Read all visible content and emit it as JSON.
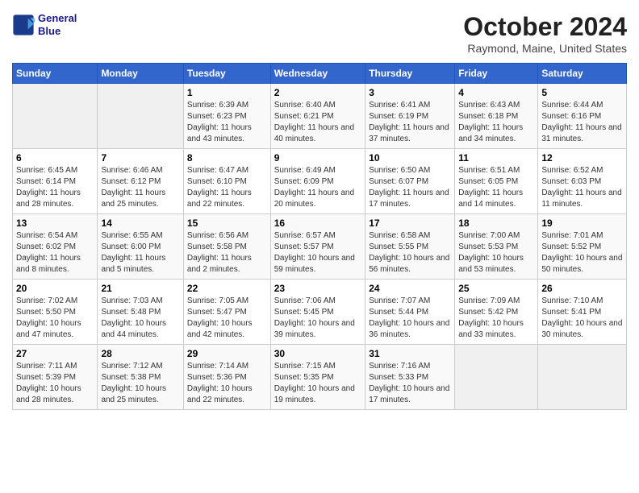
{
  "logo": {
    "line1": "General",
    "line2": "Blue"
  },
  "title": "October 2024",
  "subtitle": "Raymond, Maine, United States",
  "headers": [
    "Sunday",
    "Monday",
    "Tuesday",
    "Wednesday",
    "Thursday",
    "Friday",
    "Saturday"
  ],
  "weeks": [
    [
      {
        "day": "",
        "info": ""
      },
      {
        "day": "",
        "info": ""
      },
      {
        "day": "1",
        "info": "Sunrise: 6:39 AM\nSunset: 6:23 PM\nDaylight: 11 hours and 43 minutes."
      },
      {
        "day": "2",
        "info": "Sunrise: 6:40 AM\nSunset: 6:21 PM\nDaylight: 11 hours and 40 minutes."
      },
      {
        "day": "3",
        "info": "Sunrise: 6:41 AM\nSunset: 6:19 PM\nDaylight: 11 hours and 37 minutes."
      },
      {
        "day": "4",
        "info": "Sunrise: 6:43 AM\nSunset: 6:18 PM\nDaylight: 11 hours and 34 minutes."
      },
      {
        "day": "5",
        "info": "Sunrise: 6:44 AM\nSunset: 6:16 PM\nDaylight: 11 hours and 31 minutes."
      }
    ],
    [
      {
        "day": "6",
        "info": "Sunrise: 6:45 AM\nSunset: 6:14 PM\nDaylight: 11 hours and 28 minutes."
      },
      {
        "day": "7",
        "info": "Sunrise: 6:46 AM\nSunset: 6:12 PM\nDaylight: 11 hours and 25 minutes."
      },
      {
        "day": "8",
        "info": "Sunrise: 6:47 AM\nSunset: 6:10 PM\nDaylight: 11 hours and 22 minutes."
      },
      {
        "day": "9",
        "info": "Sunrise: 6:49 AM\nSunset: 6:09 PM\nDaylight: 11 hours and 20 minutes."
      },
      {
        "day": "10",
        "info": "Sunrise: 6:50 AM\nSunset: 6:07 PM\nDaylight: 11 hours and 17 minutes."
      },
      {
        "day": "11",
        "info": "Sunrise: 6:51 AM\nSunset: 6:05 PM\nDaylight: 11 hours and 14 minutes."
      },
      {
        "day": "12",
        "info": "Sunrise: 6:52 AM\nSunset: 6:03 PM\nDaylight: 11 hours and 11 minutes."
      }
    ],
    [
      {
        "day": "13",
        "info": "Sunrise: 6:54 AM\nSunset: 6:02 PM\nDaylight: 11 hours and 8 minutes."
      },
      {
        "day": "14",
        "info": "Sunrise: 6:55 AM\nSunset: 6:00 PM\nDaylight: 11 hours and 5 minutes."
      },
      {
        "day": "15",
        "info": "Sunrise: 6:56 AM\nSunset: 5:58 PM\nDaylight: 11 hours and 2 minutes."
      },
      {
        "day": "16",
        "info": "Sunrise: 6:57 AM\nSunset: 5:57 PM\nDaylight: 10 hours and 59 minutes."
      },
      {
        "day": "17",
        "info": "Sunrise: 6:58 AM\nSunset: 5:55 PM\nDaylight: 10 hours and 56 minutes."
      },
      {
        "day": "18",
        "info": "Sunrise: 7:00 AM\nSunset: 5:53 PM\nDaylight: 10 hours and 53 minutes."
      },
      {
        "day": "19",
        "info": "Sunrise: 7:01 AM\nSunset: 5:52 PM\nDaylight: 10 hours and 50 minutes."
      }
    ],
    [
      {
        "day": "20",
        "info": "Sunrise: 7:02 AM\nSunset: 5:50 PM\nDaylight: 10 hours and 47 minutes."
      },
      {
        "day": "21",
        "info": "Sunrise: 7:03 AM\nSunset: 5:48 PM\nDaylight: 10 hours and 44 minutes."
      },
      {
        "day": "22",
        "info": "Sunrise: 7:05 AM\nSunset: 5:47 PM\nDaylight: 10 hours and 42 minutes."
      },
      {
        "day": "23",
        "info": "Sunrise: 7:06 AM\nSunset: 5:45 PM\nDaylight: 10 hours and 39 minutes."
      },
      {
        "day": "24",
        "info": "Sunrise: 7:07 AM\nSunset: 5:44 PM\nDaylight: 10 hours and 36 minutes."
      },
      {
        "day": "25",
        "info": "Sunrise: 7:09 AM\nSunset: 5:42 PM\nDaylight: 10 hours and 33 minutes."
      },
      {
        "day": "26",
        "info": "Sunrise: 7:10 AM\nSunset: 5:41 PM\nDaylight: 10 hours and 30 minutes."
      }
    ],
    [
      {
        "day": "27",
        "info": "Sunrise: 7:11 AM\nSunset: 5:39 PM\nDaylight: 10 hours and 28 minutes."
      },
      {
        "day": "28",
        "info": "Sunrise: 7:12 AM\nSunset: 5:38 PM\nDaylight: 10 hours and 25 minutes."
      },
      {
        "day": "29",
        "info": "Sunrise: 7:14 AM\nSunset: 5:36 PM\nDaylight: 10 hours and 22 minutes."
      },
      {
        "day": "30",
        "info": "Sunrise: 7:15 AM\nSunset: 5:35 PM\nDaylight: 10 hours and 19 minutes."
      },
      {
        "day": "31",
        "info": "Sunrise: 7:16 AM\nSunset: 5:33 PM\nDaylight: 10 hours and 17 minutes."
      },
      {
        "day": "",
        "info": ""
      },
      {
        "day": "",
        "info": ""
      }
    ]
  ]
}
